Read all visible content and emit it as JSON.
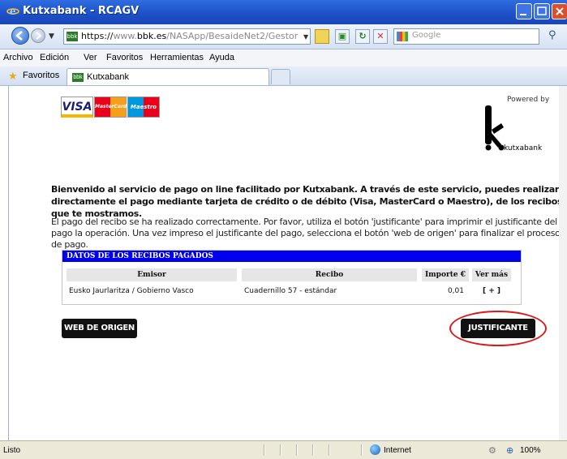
{
  "window": {
    "title": "Kutxabank - RCAGV"
  },
  "address": {
    "url_scheme_host_pre": "https://",
    "url_grey_pre": "www.",
    "url_bold": "bbk.es",
    "url_grey_post": "/NASApp/BesaideNet2/Gestor",
    "search_placeholder": "Google"
  },
  "menu": {
    "items": [
      "Archivo",
      "Edición",
      "Ver",
      "Favoritos",
      "Herramientas",
      "Ayuda"
    ]
  },
  "favorites": {
    "label": "Favoritos",
    "tab_label": "Kutxabank",
    "tab_icon_text": "bbk"
  },
  "page": {
    "cards": {
      "visa": "VISA",
      "mastercard": "MasterCard",
      "maestro": "Maestro"
    },
    "powered_by": "Powered by",
    "brand_letter": "k",
    "brand_name": "kutxabank",
    "intro": "Bienvenido al servicio de pago on line facilitado por Kutxabank. A través de este servicio, puedes realizar directamente el pago mediante tarjeta de crédito o de débito (Visa, MasterCard o Maestro), de los recibos que te mostramos.",
    "message": "El pago del recibo se ha realizado correctamente. Por favor, utiliza el botón 'justificante' para imprimir el justificante del pago la operación. Una vez impreso el justificante del pago, selecciona el botón 'web de origen' para finalizar el proceso de pago.",
    "table": {
      "title": "DATOS DE LOS RECIBOS PAGADOS",
      "headers": [
        "Emisor",
        "Recibo",
        "Importe €",
        "Ver más"
      ],
      "rows": [
        {
          "emisor": "Eusko Jaurlaritza / Gobierno Vasco",
          "recibo": "Cuadernillo 57 - estándar",
          "importe": "0,01",
          "ver_mas": "[ + ]"
        }
      ]
    },
    "buttons": {
      "web_origen": "WEB DE ORIGEN",
      "justificante": "JUSTIFICANTE"
    },
    "highlight_color": "#d91a1a"
  },
  "status": {
    "text": "Listo",
    "zone": "Internet",
    "zoom": "100%"
  }
}
